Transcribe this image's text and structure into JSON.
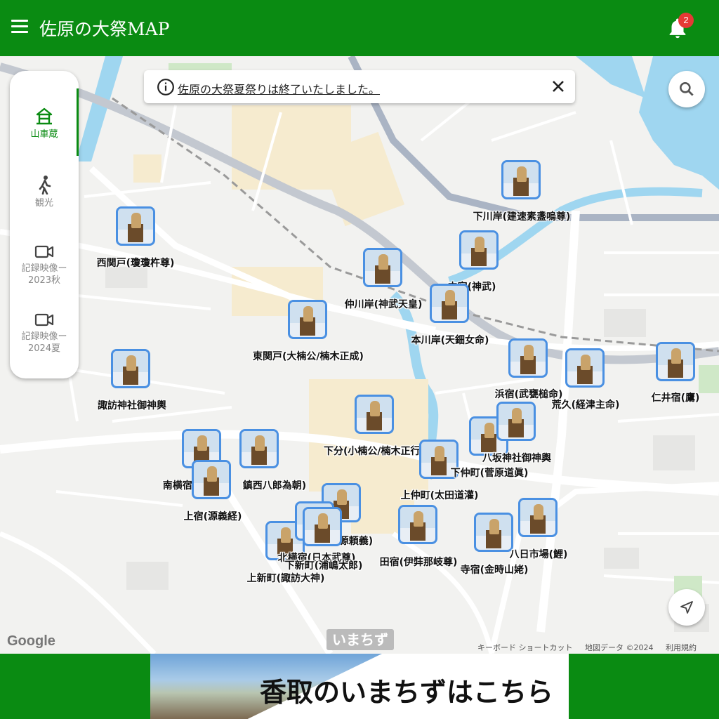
{
  "header": {
    "title": "佐原の大祭MAP",
    "notification_count": "2"
  },
  "sidebar": {
    "items": [
      {
        "label": "山車蔵",
        "icon": "shrine-icon",
        "active": true
      },
      {
        "label": "観光",
        "icon": "walking-person-icon",
        "active": false
      },
      {
        "label": "記録映像ー 2023秋",
        "icon": "video-camera-icon",
        "active": false
      },
      {
        "label": "記録映像ー 2024夏",
        "icon": "video-camera-icon",
        "active": false
      }
    ]
  },
  "notice": {
    "text": "佐原の大祭夏祭りは終了いたしました。"
  },
  "markers": [
    {
      "label": "下川岸(建速素盞嗚尊)"
    },
    {
      "label": "西関戸(瓊瓊杵尊)"
    },
    {
      "label": "中宿(神武)"
    },
    {
      "label": "仲川岸(神武天皇)"
    },
    {
      "label": "本川岸(天鈿女命)"
    },
    {
      "label": "東関戸(大楠公/楠木正成)"
    },
    {
      "label": "諏訪神社御神輿"
    },
    {
      "label": "浜宿(武甕槌命)"
    },
    {
      "label": "荒久(経津主命)"
    },
    {
      "label": "仁井宿(鷹)"
    },
    {
      "label": "下分(小楠公/楠木正行)"
    },
    {
      "label": "八坂神社御神輿"
    },
    {
      "label": "下仲町(菅原道眞)"
    },
    {
      "label": "上仲町(太田道灌)"
    },
    {
      "label": "南横宿("
    },
    {
      "label": "鎮西八郎為朝)"
    },
    {
      "label": "上宿(源義経)"
    },
    {
      "label": "源頼義)"
    },
    {
      "label": "北横宿(日本武尊)"
    },
    {
      "label": "下新町(浦嶋太郎)"
    },
    {
      "label": "上新町(諏訪大神)"
    },
    {
      "label": "田宿(伊弉那岐尊)"
    },
    {
      "label": "寺宿(金時山姥)"
    },
    {
      "label": "八日市場(鯉)"
    }
  ],
  "map_footer": {
    "google": "Google",
    "imachizu": "いまちず",
    "keyboard": "キーボード ショートカット",
    "map_data": "地図データ ©2024",
    "terms": "利用規約"
  },
  "banner": {
    "text": "香取のいまちずはこちら"
  },
  "colors": {
    "brand_green": "#0a8b12",
    "marker_blue": "#4a90e2",
    "water": "#9fd6f0",
    "badge_red": "#e53935"
  }
}
